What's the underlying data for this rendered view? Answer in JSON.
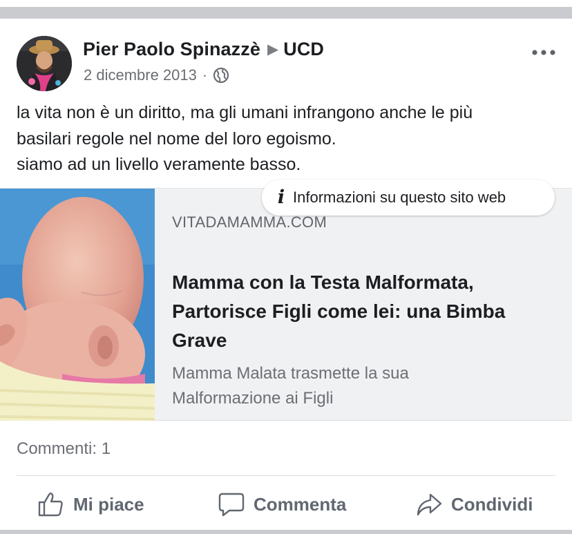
{
  "post": {
    "author": "Pier Paolo Spinazzè",
    "separator_icon": "triangle-right-icon",
    "group": "UCD",
    "date": "2 dicembre 2013",
    "dot": "·",
    "privacy_icon": "globe-icon",
    "more_icon": "more-horizontal-icon",
    "text_lines": [
      "la vita non è un diritto, ma gli umani infrangono anche le più",
      "basilari regole nel nome del loro egoismo.",
      "siamo ad un livello veramente basso."
    ]
  },
  "link_preview": {
    "info_button": "Informazioni su questo sito web",
    "info_icon": "info-icon",
    "domain": "VITADAMAMMA.COM",
    "title_lines": [
      "Mamma con la Testa Malformata,",
      "Partorisce Figli come lei: una Bimba",
      "Grave"
    ],
    "description_lines": [
      "Mamma Malata trasmette la sua",
      "Malformazione ai Figli"
    ]
  },
  "stats": {
    "comments": "Commenti: 1"
  },
  "actions": {
    "like": "Mi piace",
    "comment": "Commenta",
    "share": "Condividi"
  },
  "colors": {
    "text": "#1c1e21",
    "secondary_text": "#6b6e73",
    "card_background": "#f0f1f3",
    "divider": "#dadde1",
    "separator_bar": "#cacbcf"
  }
}
